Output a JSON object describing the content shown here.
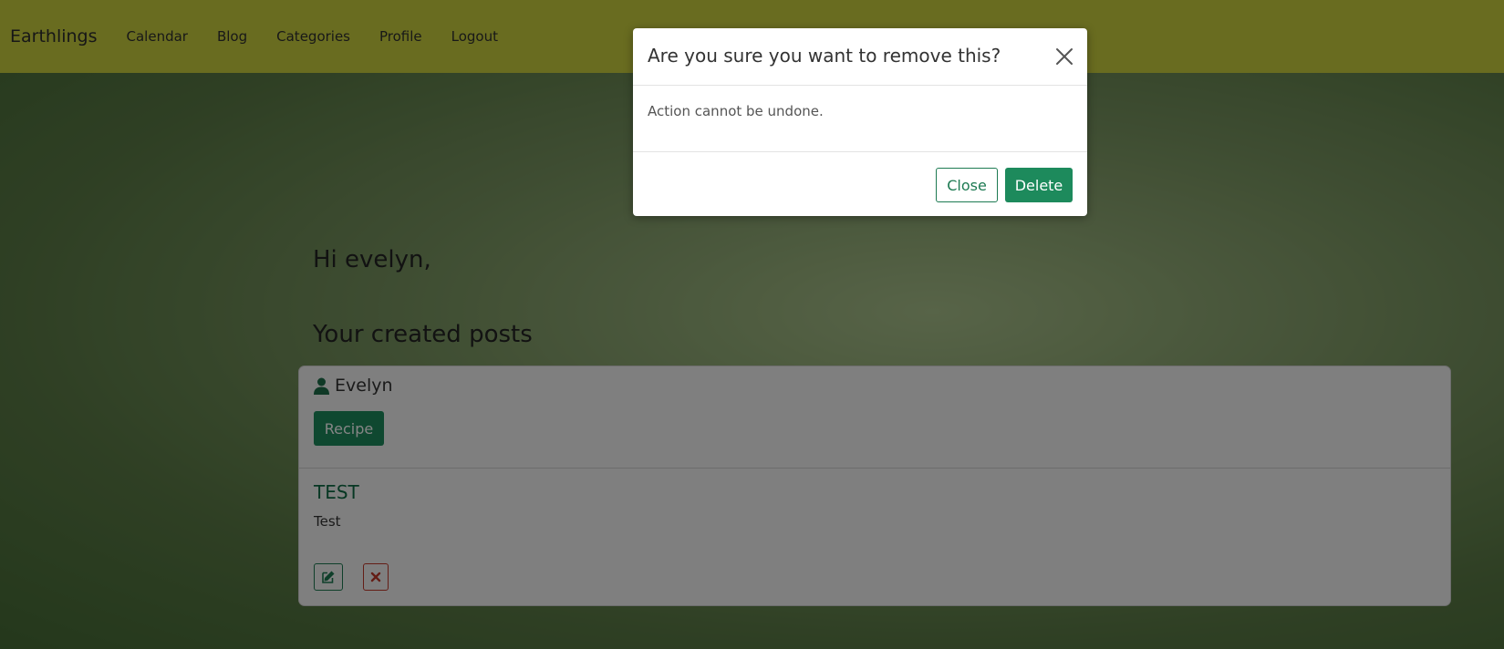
{
  "navbar": {
    "brand": "Earthlings",
    "links": [
      "Calendar",
      "Blog",
      "Categories",
      "Profile",
      "Logout"
    ]
  },
  "page": {
    "greeting": "Hi evelyn,",
    "section_title": "Your created posts"
  },
  "post": {
    "author": "Evelyn",
    "category": "Recipe",
    "title": "TEST",
    "body": "Test",
    "icons": {
      "author": "user-icon",
      "edit": "edit-icon",
      "delete": "close-x-icon"
    }
  },
  "modal": {
    "title": "Are you sure you want to remove this?",
    "body": "Action cannot be undone.",
    "close_label": "Close",
    "delete_label": "Delete",
    "close_icon": "close-icon"
  },
  "colors": {
    "navbar": "#c9cf3f",
    "primary_green": "#1d8a5c",
    "danger_red": "#c0392b"
  }
}
